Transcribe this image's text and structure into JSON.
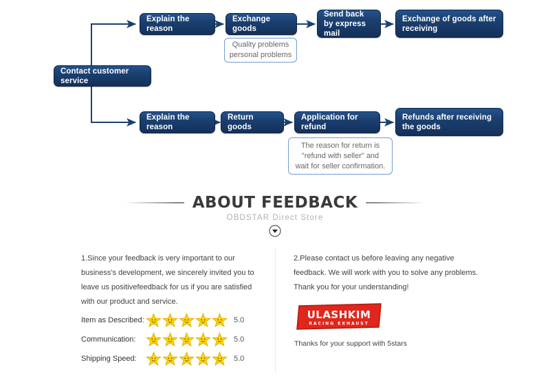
{
  "flow": {
    "root": {
      "label": "Contact customer service"
    },
    "row_exchange": [
      {
        "label": "Explain the reason"
      },
      {
        "label": "Exchange goods"
      },
      {
        "label": "Send back by express mail"
      },
      {
        "label": "Exchange of goods after receiving"
      }
    ],
    "row_refund": [
      {
        "label": "Explain the reason"
      },
      {
        "label": "Return goods"
      },
      {
        "label": "Application for refund"
      },
      {
        "label": "Refunds after receiving the goods"
      }
    ],
    "callouts": [
      {
        "line1": "Quality problems",
        "line2": "personal problems"
      },
      {
        "line1": "The reason for return is",
        "line2": "\"refund with seller\" and",
        "line3": "wait for seller confirmation."
      }
    ],
    "colors": {
      "node_fill": "#1b4070",
      "node_border": "#0f2547",
      "callout_border": "#6f9bd1",
      "connector": "#1b4070"
    }
  },
  "feedback": {
    "title": "ABOUT FEEDBACK",
    "subtitle": "OBDSTAR Direct Store",
    "expand_icon": "chevron-down-circle-icon",
    "left_paragraph": "1.Since your feedback is very important to our business's development, we sincerely invited you to leave us positivefeedback for us if you are satisfied with our product and service.",
    "right_paragraph": "2.Please contact us before leaving any negative feedback. We will work with you to solve any problems. Thank you for your understanding!",
    "ratings": [
      {
        "label": "Item as Described:",
        "stars": 5,
        "score": "5.0"
      },
      {
        "label": "Communication:",
        "stars": 5,
        "score": "5.0"
      },
      {
        "label": "Shipping Speed:",
        "stars": 5,
        "score": "5.0"
      }
    ],
    "star_color": "#ffd60a",
    "logo": {
      "name": "ULASHKIM",
      "tagline": "RACING EXHAUST",
      "color": "#e1261c"
    },
    "logo_caption": "Thanks for your support with 5stars"
  }
}
